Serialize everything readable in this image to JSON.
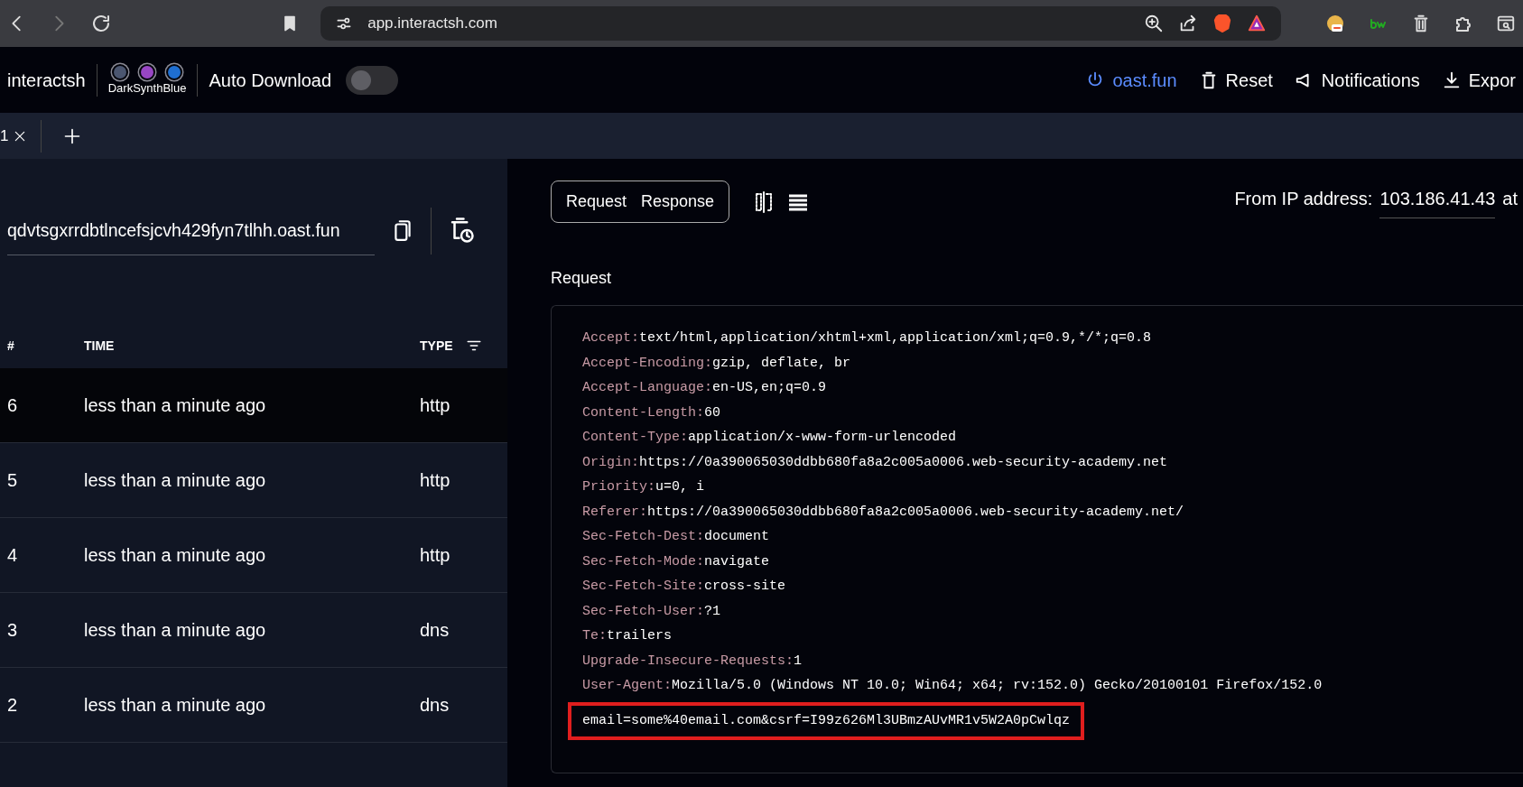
{
  "browser": {
    "url": "app.interactsh.com"
  },
  "header": {
    "brand": "interactsh",
    "theme_name": "DarkSynthBlue",
    "themes": [
      {
        "color": "#4b5670"
      },
      {
        "color": "#9846c4"
      },
      {
        "color": "#1f6fd1"
      }
    ],
    "auto_download": {
      "label": "Auto Download",
      "on": false
    },
    "actions": [
      {
        "kind": "server",
        "label": "oast.fun"
      },
      {
        "kind": "reset",
        "label": "Reset"
      },
      {
        "kind": "notifications",
        "label": "Notifications"
      },
      {
        "kind": "export",
        "label": "Expor"
      }
    ]
  },
  "tabs": [
    {
      "label": "1",
      "selected": true
    }
  ],
  "domain": "qdvtsgxrrdbtlncefsjcvh429fyn7tlhh.oast.fun",
  "table": {
    "columns": [
      "#",
      "TIME",
      "TYPE"
    ],
    "rows": [
      {
        "id": "6",
        "time": "less than a minute ago",
        "type": "http",
        "selected": true
      },
      {
        "id": "5",
        "time": "less than a minute ago",
        "type": "http",
        "selected": false
      },
      {
        "id": "4",
        "time": "less than a minute ago",
        "type": "http",
        "selected": false
      },
      {
        "id": "3",
        "time": "less than a minute ago",
        "type": "dns",
        "selected": false
      },
      {
        "id": "2",
        "time": "less than a minute ago",
        "type": "dns",
        "selected": false
      }
    ]
  },
  "detail": {
    "toggle": [
      "Request",
      "Response"
    ],
    "from_label": "From IP address:",
    "ip": "103.186.41.43",
    "at": "at",
    "section_title": "Request",
    "headers": [
      {
        "name": "Accept:",
        "value": "text/html,application/xhtml+xml,application/xml;q=0.9,*/*;q=0.8"
      },
      {
        "name": "Accept-Encoding:",
        "value": "gzip, deflate, br"
      },
      {
        "name": "Accept-Language:",
        "value": "en-US,en;q=0.9"
      },
      {
        "name": "Content-Length:",
        "value": "60"
      },
      {
        "name": "Content-Type:",
        "value": "application/x-www-form-urlencoded"
      },
      {
        "name": "Origin:",
        "value": "https://0a390065030ddbb680fa8a2c005a0006.web-security-academy.net"
      },
      {
        "name": "Priority:",
        "value": "u=0, i"
      },
      {
        "name": "Referer:",
        "value": "https://0a390065030ddbb680fa8a2c005a0006.web-security-academy.net/"
      },
      {
        "name": "Sec-Fetch-Dest:",
        "value": "document"
      },
      {
        "name": "Sec-Fetch-Mode:",
        "value": "navigate"
      },
      {
        "name": "Sec-Fetch-Site:",
        "value": "cross-site"
      },
      {
        "name": "Sec-Fetch-User:",
        "value": "?1"
      },
      {
        "name": "Te:",
        "value": "trailers"
      },
      {
        "name": "Upgrade-Insecure-Requests:",
        "value": "1"
      },
      {
        "name": "User-Agent:",
        "value": "Mozilla/5.0 (Windows NT 10.0; Win64; x64; rv:152.0) Gecko/20100101 Firefox/152.0"
      }
    ],
    "body": {
      "text": "email=some%40email.com&csrf=I99z626Ml3UBmzAUvMR1v5W2A0pCwlqz",
      "highlighted": true
    }
  }
}
